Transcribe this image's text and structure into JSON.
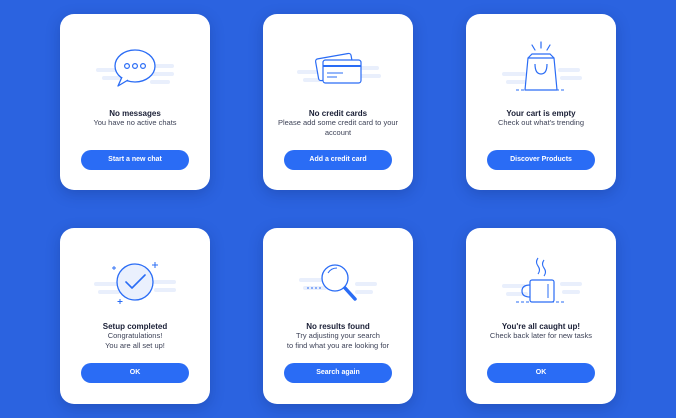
{
  "colors": {
    "background": "#2b63e0",
    "card": "#ffffff",
    "button": "#2a6cf5",
    "icon_stroke": "#2a6cf5"
  },
  "cards": [
    {
      "icon": "chat-bubble-icon",
      "title": "No messages",
      "lines": [
        "You have no active chats"
      ],
      "button": "Start a new chat"
    },
    {
      "icon": "credit-cards-icon",
      "title": "No credit cards",
      "lines": [
        "Please add some credit card to your",
        "account"
      ],
      "button": "Add a credit card"
    },
    {
      "icon": "shopping-bag-icon",
      "title": "Your cart is empty",
      "lines": [
        "Check out what's trending"
      ],
      "button": "Discover Products"
    },
    {
      "icon": "checkmark-circle-icon",
      "title": "Setup completed",
      "lines": [
        "Congratulations!",
        "You are all set up!"
      ],
      "button": "OK"
    },
    {
      "icon": "magnifier-icon",
      "title": "No results found",
      "lines": [
        "Try adjusting your search",
        "to find what you are looking for"
      ],
      "button": "Search again"
    },
    {
      "icon": "coffee-mug-icon",
      "title": "You're all caught up!",
      "lines": [
        "Check back later for new tasks"
      ],
      "button": "OK"
    }
  ]
}
